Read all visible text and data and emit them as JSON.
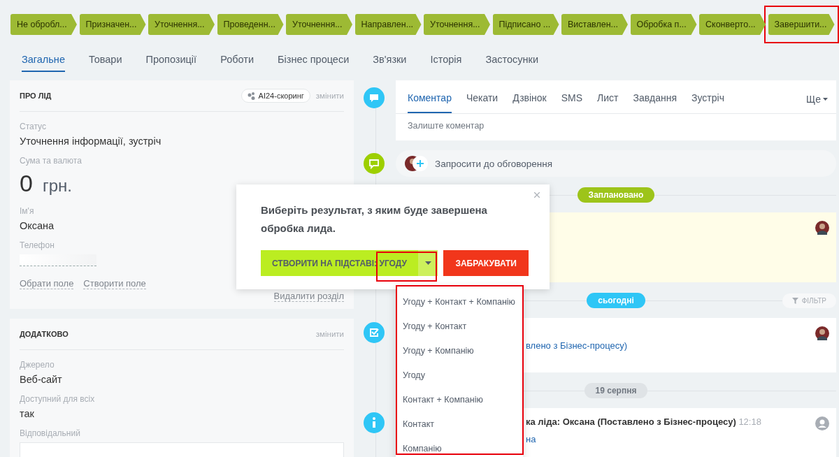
{
  "stages": [
    {
      "label": "Не обробл...",
      "highlighted": false
    },
    {
      "label": "Призначен...",
      "highlighted": false
    },
    {
      "label": "Уточнення...",
      "highlighted": false
    },
    {
      "label": "Проведенн...",
      "highlighted": false
    },
    {
      "label": "Уточнення...",
      "highlighted": false
    },
    {
      "label": "Направлен...",
      "highlighted": false
    },
    {
      "label": "Уточнення...",
      "highlighted": false
    },
    {
      "label": "Підписано ...",
      "highlighted": false
    },
    {
      "label": "Виставлен...",
      "highlighted": false
    },
    {
      "label": "Обробка п...",
      "highlighted": false
    },
    {
      "label": "Сконверто...",
      "highlighted": false
    },
    {
      "label": "Завершити...",
      "highlighted": true
    }
  ],
  "tabs": [
    {
      "label": "Загальне",
      "selected": true
    },
    {
      "label": "Товари",
      "selected": false
    },
    {
      "label": "Пропозиції",
      "selected": false
    },
    {
      "label": "Роботи",
      "selected": false
    },
    {
      "label": "Бізнес процеси",
      "selected": false
    },
    {
      "label": "Зв'язки",
      "selected": false
    },
    {
      "label": "Історія",
      "selected": false
    },
    {
      "label": "Застосунки",
      "selected": false
    }
  ],
  "about_card": {
    "title": "ПРО ЛІД",
    "scoring_badge": "AI24-скоринг",
    "edit_link": "змінити",
    "fields": [
      {
        "kind": "text",
        "label": "Статус",
        "value": "Уточнення інформації, зустріч"
      },
      {
        "kind": "amount",
        "label": "Сума та валюта",
        "value": "0",
        "currency": "грн."
      },
      {
        "kind": "text",
        "label": "Ім'я",
        "value": "Оксана"
      },
      {
        "kind": "masked",
        "label": "Телефон"
      }
    ],
    "actions": [
      "Обрати поле",
      "Створити поле"
    ],
    "delete_link": "Видалити розділ"
  },
  "extra_card": {
    "title": "ДОДАТКОВО",
    "edit_link": "змінити",
    "fields": [
      {
        "kind": "text",
        "label": "Джерело",
        "value": "Веб-сайт"
      },
      {
        "kind": "text",
        "label": "Доступний для всіх",
        "value": "так"
      },
      {
        "kind": "input",
        "label": "Відповідальний"
      }
    ]
  },
  "composer": {
    "tabs": [
      {
        "label": "Коментар",
        "selected": true
      },
      {
        "label": "Чекати",
        "selected": false
      },
      {
        "label": "Дзвінок",
        "selected": false
      },
      {
        "label": "SMS",
        "selected": false
      },
      {
        "label": "Лист",
        "selected": false
      },
      {
        "label": "Завдання",
        "selected": false
      },
      {
        "label": "Зустріч",
        "selected": false
      }
    ],
    "more": "Ще",
    "placeholder": "Залиште коментар"
  },
  "invite": {
    "label": "Запросити до обговорення"
  },
  "timeline": [
    {
      "kind": "divider",
      "label": "Заплановано",
      "color": "#9dc41a"
    },
    {
      "kind": "scheduled"
    },
    {
      "kind": "divider",
      "label": "сьогодні",
      "color": "#2fc6f6",
      "filter": "ФІЛЬТР"
    },
    {
      "kind": "task",
      "link": "влено з Бізнес-процесу)"
    },
    {
      "kind": "divider",
      "label": "19 серпня",
      "color": "#dfe3e6"
    },
    {
      "kind": "info",
      "title": "ка ліда: Оксана (Поставлено з Бізнес-процесу)",
      "time": "12:18",
      "link": "на"
    }
  ],
  "popup": {
    "message": "Виберіть результат, з яким буде завершена обробка лида.",
    "primary": "СТВОРИТИ НА ПІДСТАВІ: УГОДУ",
    "reject": "ЗАБРАКУВАТИ",
    "toggle_highlighted": true,
    "menu_open": true,
    "menu_highlighted": true,
    "options": [
      "Угоду + Контакт + Компанію",
      "Угоду + Контакт",
      "Угоду + Компанію",
      "Угоду",
      "Контакт + Компанію",
      "Контакт",
      "Компанію"
    ]
  }
}
